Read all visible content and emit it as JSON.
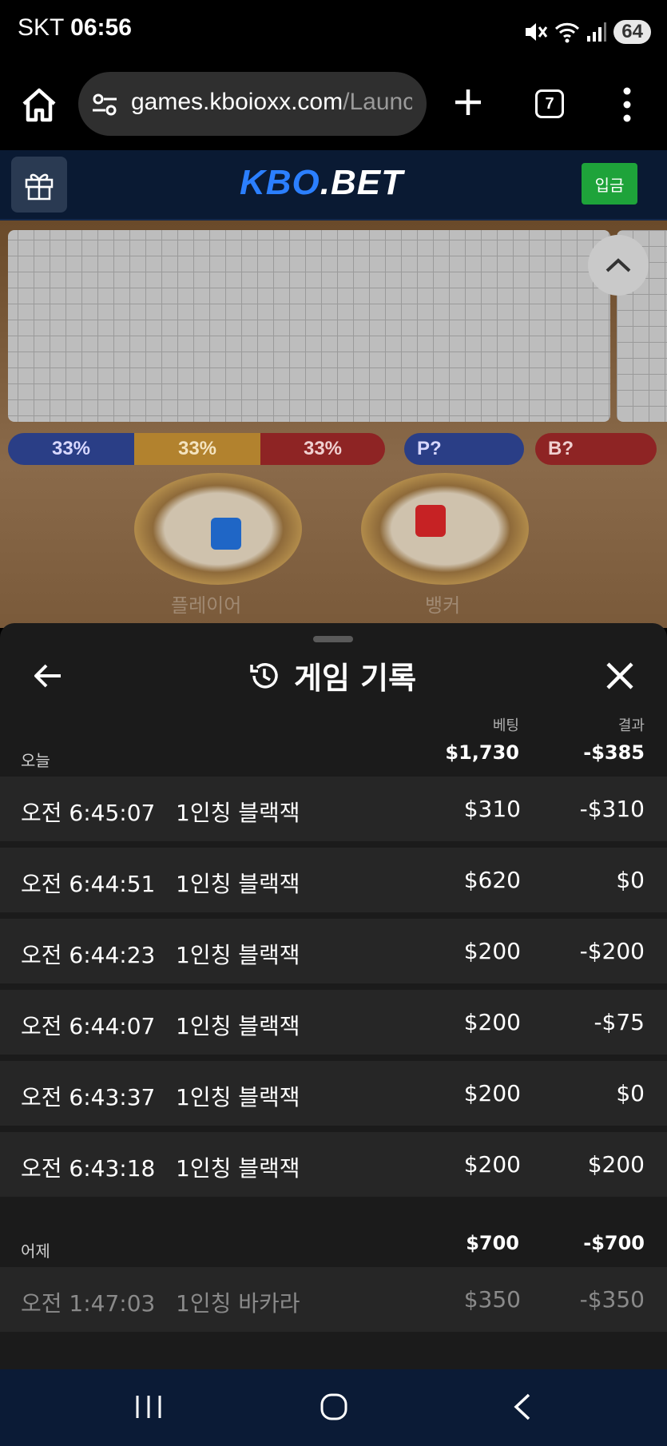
{
  "status_bar": {
    "carrier": "SKT",
    "time": "06:56",
    "battery": "64"
  },
  "browser": {
    "url_host": "games.kboioxx.com",
    "url_path": "/Launc",
    "tab_count": "7"
  },
  "site": {
    "logo_main": "KBO",
    "logo_suffix": ".BET",
    "deposit_label": "입금"
  },
  "game": {
    "player_pct": "33%",
    "tie_pct": "33%",
    "banker_pct": "33%",
    "player_predict": "P?",
    "banker_predict": "B?",
    "player_label": "플레이어",
    "banker_label": "뱅커"
  },
  "history": {
    "title": "게임 기록",
    "col_bet": "베팅",
    "col_result": "결과",
    "today": {
      "label": "오늘",
      "total_bet": "$1,730",
      "total_result": "-$385",
      "rows": [
        {
          "time": "오전 6:45:07",
          "game": "1인칭 블랙잭",
          "bet": "$310",
          "result": "-$310"
        },
        {
          "time": "오전 6:44:51",
          "game": "1인칭 블랙잭",
          "bet": "$620",
          "result": "$0"
        },
        {
          "time": "오전 6:44:23",
          "game": "1인칭 블랙잭",
          "bet": "$200",
          "result": "-$200"
        },
        {
          "time": "오전 6:44:07",
          "game": "1인칭 블랙잭",
          "bet": "$200",
          "result": "-$75"
        },
        {
          "time": "오전 6:43:37",
          "game": "1인칭 블랙잭",
          "bet": "$200",
          "result": "$0"
        },
        {
          "time": "오전 6:43:18",
          "game": "1인칭 블랙잭",
          "bet": "$200",
          "result": "$200"
        }
      ]
    },
    "yesterday": {
      "label": "어제",
      "total_bet": "$700",
      "total_result": "-$700",
      "rows": [
        {
          "time": "오전 1:47:03",
          "game": "1인칭 바카라",
          "bet": "$350",
          "result": "-$350"
        }
      ]
    }
  },
  "colors": {
    "accent_blue": "#2b7fff",
    "deposit_green": "#1ea33a",
    "sheet_bg": "#1b1b1b",
    "row_bg": "#262626"
  }
}
